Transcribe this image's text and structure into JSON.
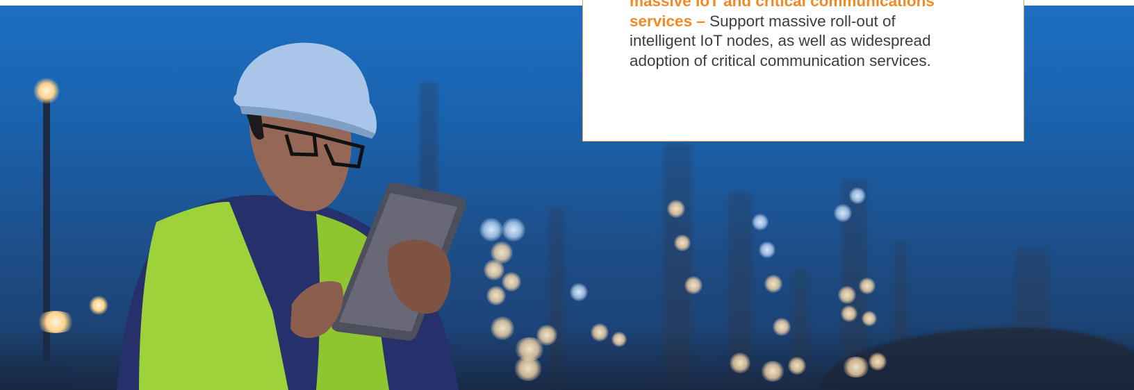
{
  "card": {
    "highlight": "massive IoT and critical communications services –",
    "body": " Support massive roll-out of intelligent IoT nodes, as well as widespread adoption of critical communication services."
  },
  "photo": {
    "subject": "worker-with-tablet"
  },
  "colors": {
    "accent": "#f08a24",
    "card_border": "#e8a25c",
    "body_text": "#3c3c46",
    "sky": "#1d6ec2"
  }
}
